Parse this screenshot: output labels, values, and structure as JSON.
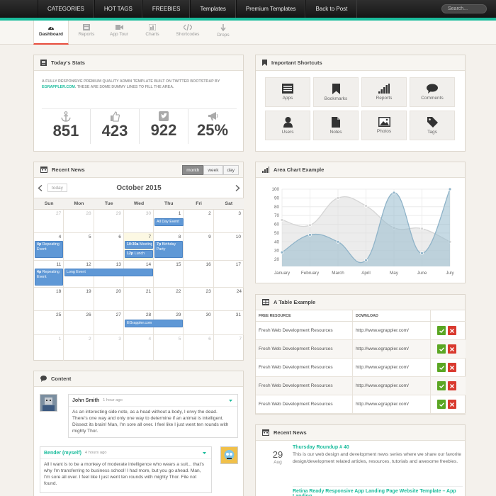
{
  "topnav": {
    "items": [
      "CATEGORIES",
      "HOT TAGS",
      "FREEBIES",
      "Templates",
      "Premium Templates",
      "Back to Post"
    ],
    "search_placeholder": "Search..."
  },
  "subnav": {
    "tabs": [
      {
        "label": "Dashboard",
        "icon": "dashboard-gauge-icon",
        "active": true
      },
      {
        "label": "Reports",
        "icon": "list-icon"
      },
      {
        "label": "App Tour",
        "icon": "video-camera-icon"
      },
      {
        "label": "Charts",
        "icon": "bar-chart-icon"
      },
      {
        "label": "Shortcodes",
        "icon": "code-icon"
      },
      {
        "label": "Drops",
        "icon": "download-arrow-icon"
      }
    ]
  },
  "stats": {
    "title": "Today's Stats",
    "desc_pre": "A FULLY RESPONSIVE PREMIUM QUALITY ADMIN TEMPLATE BUILT ON TWITTER BOOTSTRAP BY",
    "desc_link": "EGRAPPLER.COM",
    "desc_post": ". THESE ARE SOME DUMMY LINES TO FILL THE AREA.",
    "items": [
      {
        "value": "851",
        "icon": "anchor-icon"
      },
      {
        "value": "423",
        "icon": "thumbs-up-icon"
      },
      {
        "value": "922",
        "icon": "twitter-bird-icon"
      },
      {
        "value": "25%",
        "icon": "bullhorn-icon"
      }
    ]
  },
  "shortcuts": {
    "title": "Important Shortcuts",
    "items": [
      {
        "label": "Apps",
        "icon": "apps-list-icon"
      },
      {
        "label": "Bookmarks",
        "icon": "bookmark-icon"
      },
      {
        "label": "Reports",
        "icon": "signal-bars-icon"
      },
      {
        "label": "Comments",
        "icon": "comment-bubble-icon"
      },
      {
        "label": "Users",
        "icon": "user-icon"
      },
      {
        "label": "Notes",
        "icon": "file-icon"
      },
      {
        "label": "Photos",
        "icon": "picture-icon"
      },
      {
        "label": "Tags",
        "icon": "tag-icon"
      }
    ]
  },
  "calendar": {
    "title": "Recent News",
    "views": [
      "month",
      "week",
      "day"
    ],
    "active_view": "month",
    "today_label": "today",
    "month_label": "October 2015",
    "dow": [
      "Sun",
      "Mon",
      "Tue",
      "Wed",
      "Thu",
      "Fri",
      "Sat"
    ],
    "weeks": [
      [
        "27",
        "28",
        "29",
        "30",
        "1",
        "2",
        "3"
      ],
      [
        "4",
        "5",
        "6",
        "7",
        "8",
        "9",
        "10"
      ],
      [
        "11",
        "12",
        "13",
        "14",
        "15",
        "16",
        "17"
      ],
      [
        "18",
        "19",
        "20",
        "21",
        "22",
        "23",
        "24"
      ],
      [
        "25",
        "26",
        "27",
        "28",
        "29",
        "30",
        "31"
      ],
      [
        "1",
        "2",
        "3",
        "4",
        "5",
        "6",
        "7"
      ]
    ],
    "events": {
      "all_day": "All Day Event",
      "repeat1_time": "4p",
      "repeat1_title": "Repeating Event",
      "meeting_time": "10:30a",
      "meeting_title": "Meeting",
      "lunch_time": "12p",
      "lunch_title": "Lunch",
      "bday_time": "7p",
      "bday_title": "Birthday Party",
      "repeat2_time": "4p",
      "repeat2_title": "Repeating Event",
      "long": "Long Event",
      "egrappler": "EGrappler.com"
    }
  },
  "area_chart": {
    "title": "Area Chart Example"
  },
  "chart_data": {
    "type": "area",
    "categories": [
      "January",
      "February",
      "March",
      "April",
      "May",
      "June",
      "July"
    ],
    "ylim": [
      0,
      100
    ],
    "yticks": [
      20,
      30,
      40,
      50,
      60,
      70,
      80,
      90,
      100
    ],
    "series": [
      {
        "values": [
          65,
          59,
          90,
          81,
          56,
          55,
          40
        ],
        "color": "#dcdcdc"
      },
      {
        "values": [
          28,
          48,
          40,
          19,
          96,
          27,
          100
        ],
        "color": "#97bbcd"
      }
    ],
    "grid": true
  },
  "table": {
    "title": "A Table Example",
    "headers": [
      "FREE RESOURCE",
      "DOWNLOAD",
      ""
    ],
    "rows": [
      {
        "resource": "Fresh Web Development Resources",
        "url": "http://www.egrappler.com/"
      },
      {
        "resource": "Fresh Web Development Resources",
        "url": "http://www.egrappler.com/"
      },
      {
        "resource": "Fresh Web Development Resources",
        "url": "http://www.egrappler.com/"
      },
      {
        "resource": "Fresh Web Development Resources",
        "url": "http://www.egrappler.com/"
      },
      {
        "resource": "Fresh Web Development Resources",
        "url": "http://www.egrappler.com/"
      }
    ]
  },
  "content": {
    "title": "Content",
    "comments": [
      {
        "author": "John Smith",
        "time": "1 hour ago",
        "text": "As an interesting side note, as a head without a body, I envy the dead. There's one way and only one way to determine if an animal is intelligent. Dissect its brain! Man, I'm sore all over. I feel like I just went ten rounds with mighty Thor."
      },
      {
        "author": "Bender (myself)",
        "time": "4 hours ago",
        "text": "All I want is to be a monkey of moderate intelligence who wears a suit... that's why I'm transferring to business school! I had more, but you go ahead. Man, I'm sore all over. I feel like I just went ten rounds with mighty Thor. File not found."
      }
    ]
  },
  "news": {
    "title": "Recent News",
    "items": [
      {
        "day": "29",
        "month": "Aug",
        "title": "Thursday Roundup # 40",
        "text": "This is our web design and development news series where we share our favorite design/development related articles, resources, tutorials and awesome freebies."
      },
      {
        "title": "Retina Ready Responsive App Landing Page Website Template – App Landing"
      }
    ]
  }
}
